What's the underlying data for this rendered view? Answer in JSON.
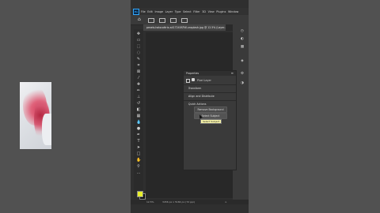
{
  "menubar": {
    "logo": "Ps",
    "items": [
      "File",
      "Edit",
      "Image",
      "Layer",
      "Type",
      "Select",
      "Filter",
      "3D",
      "View",
      "Plugins",
      "Window"
    ]
  },
  "document": {
    "tab_title": "pexels-halocottrix-a417240SFW-unsplash.jpg @ 12.5% (Layer..."
  },
  "properties": {
    "title": "Properties",
    "menu_glyph": "≡",
    "layer_type": "Pixel Layer",
    "sections": [
      "Transform",
      "Align and Distribute",
      "Quick Actions"
    ],
    "buttons": [
      "Remove Background",
      "Select Subject"
    ],
    "tooltip": "Select Subject"
  },
  "status": {
    "zoom": "12.5%",
    "doc_info": "3456 px x 5184 px (72 ppi)",
    "arrow": ">"
  },
  "colors": {
    "foreground": "#e8ef2c",
    "background": "#111111",
    "accent": "#31a8ff"
  },
  "icons": [
    "home-icon",
    "move-icon",
    "marquee-icon",
    "lasso-icon",
    "crop-icon",
    "eyedropper-icon",
    "brush-icon",
    "eraser-icon",
    "gradient-icon",
    "pen-icon",
    "type-icon",
    "hand-icon",
    "zoom-icon"
  ]
}
